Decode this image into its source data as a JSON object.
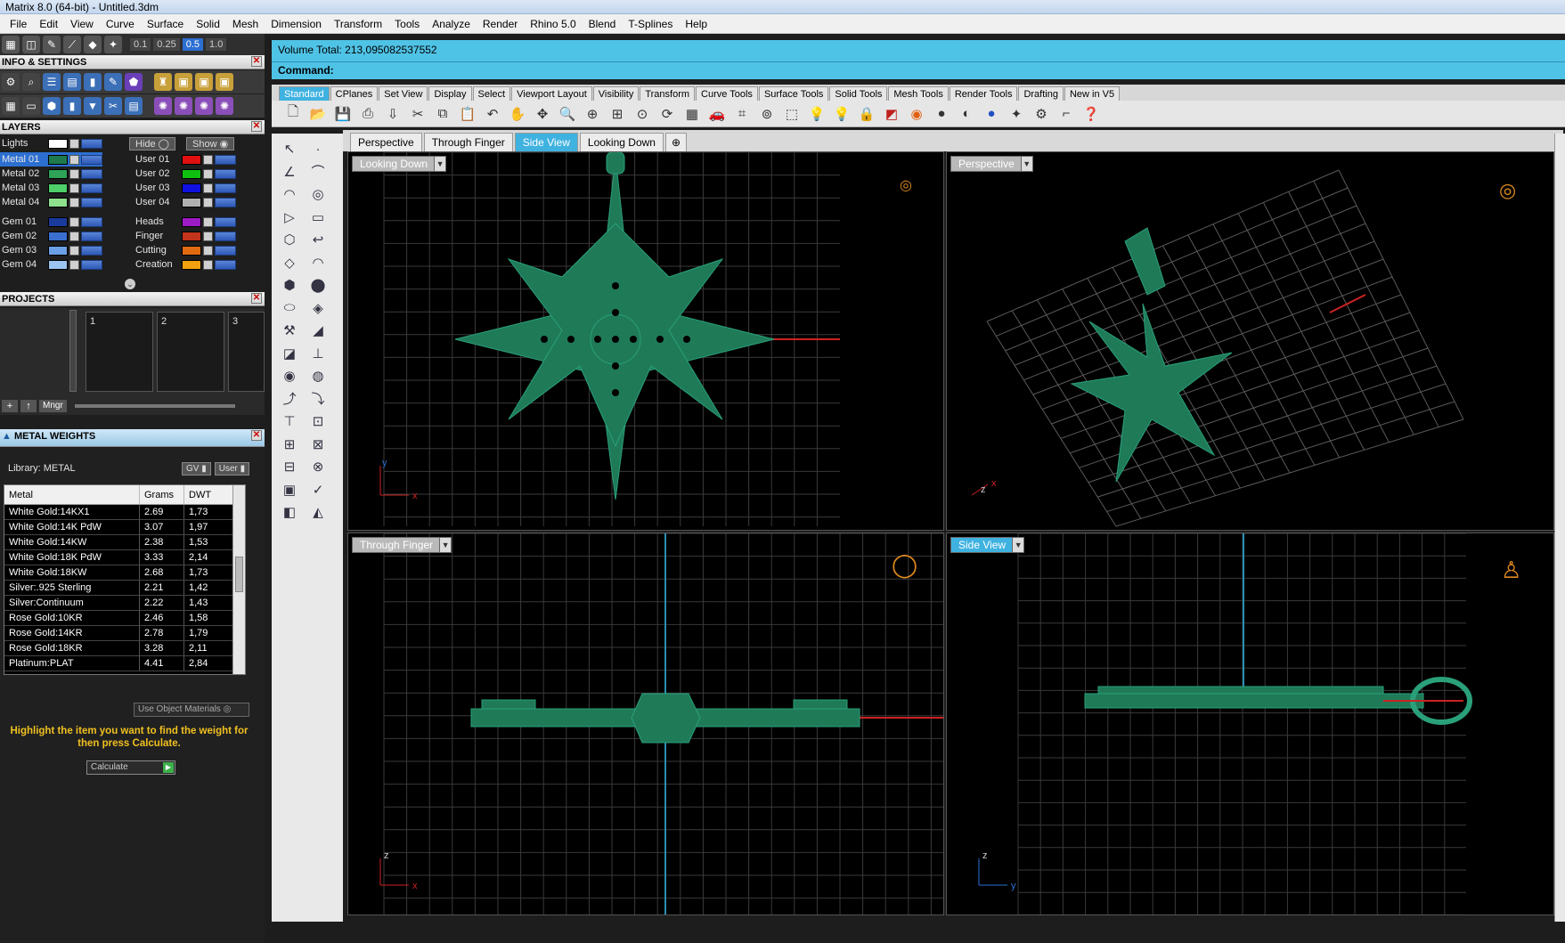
{
  "window": {
    "title": "Matrix 8.0 (64-bit) - Untitled.3dm"
  },
  "menu": [
    "File",
    "Edit",
    "View",
    "Curve",
    "Surface",
    "Solid",
    "Mesh",
    "Dimension",
    "Transform",
    "Tools",
    "Analyze",
    "Render",
    "Rhino 5.0",
    "Blend",
    "T-Splines",
    "Help"
  ],
  "toolbar": {
    "zoom_values": [
      "0.1",
      "0.25",
      "0.5",
      "1.0"
    ]
  },
  "info_settings": {
    "header": "INFO & SETTINGS"
  },
  "layers": {
    "header": "LAYERS",
    "lights_label": "Lights",
    "hide_label": "Hide",
    "show_label": "Show",
    "left": [
      {
        "name": "Metal 01",
        "color": "#1e7a4c"
      },
      {
        "name": "Metal 02",
        "color": "#2fa357"
      },
      {
        "name": "Metal 03",
        "color": "#4fcf6a"
      },
      {
        "name": "Metal 04",
        "color": "#8fe08d"
      },
      {
        "name": "Gem 01",
        "color": "#1a3a9c"
      },
      {
        "name": "Gem 02",
        "color": "#3a6fd0"
      },
      {
        "name": "Gem 03",
        "color": "#6b9fe6"
      },
      {
        "name": "Gem 04",
        "color": "#9cc4f0"
      }
    ],
    "right": [
      {
        "name": "User 01",
        "color": "#e01010"
      },
      {
        "name": "User 02",
        "color": "#10c010"
      },
      {
        "name": "User 03",
        "color": "#1010e0"
      },
      {
        "name": "User 04",
        "color": "#b0b0b0"
      },
      {
        "name": "Heads",
        "color": "#9b1cc4"
      },
      {
        "name": "Finger",
        "color": "#c2341c"
      },
      {
        "name": "Cutting",
        "color": "#e06a10"
      },
      {
        "name": "Creation",
        "color": "#f0a010"
      }
    ]
  },
  "projects": {
    "header": "PROJECTS",
    "slots": [
      "1",
      "2",
      "3"
    ],
    "manager_label": "Mngr"
  },
  "metal_weights": {
    "header": "METAL WEIGHTS",
    "library_label": "Library: METAL",
    "gv_label": "GV",
    "user_label": "User",
    "columns": [
      "Metal",
      "Grams",
      "DWT"
    ],
    "rows": [
      [
        "White Gold:14KX1",
        "2.69",
        "1,73"
      ],
      [
        "White Gold:14K PdW",
        "3.07",
        "1,97"
      ],
      [
        "White Gold:14KW",
        "2.38",
        "1,53"
      ],
      [
        "White Gold:18K PdW",
        "3.33",
        "2,14"
      ],
      [
        "White Gold:18KW",
        "2.68",
        "1,73"
      ],
      [
        "Silver:.925 Sterling",
        "2.21",
        "1,42"
      ],
      [
        "Silver:Continuum",
        "2.22",
        "1,43"
      ],
      [
        "Rose Gold:10KR",
        "2.46",
        "1,58"
      ],
      [
        "Rose Gold:14KR",
        "2.78",
        "1,79"
      ],
      [
        "Rose Gold:18KR",
        "3.28",
        "2,11"
      ],
      [
        "Platinum:PLAT",
        "4.41",
        "2,84"
      ]
    ],
    "use_object_materials": "Use Object Materials",
    "hint": "Highlight the item you want to find the weight for then press Calculate.",
    "calculate_label": "Calculate"
  },
  "status": {
    "volume_text": "Volume Total: 213,095082537552",
    "command_label": "Command:"
  },
  "tabs": [
    "Standard",
    "CPlanes",
    "Set View",
    "Display",
    "Select",
    "Viewport Layout",
    "Visibility",
    "Transform",
    "Curve Tools",
    "Surface Tools",
    "Solid Tools",
    "Mesh Tools",
    "Render Tools",
    "Drafting",
    "New in V5"
  ],
  "viewport_tabs": [
    "Perspective",
    "Through Finger",
    "Side View",
    "Looking Down"
  ],
  "viewports": {
    "top_left": "Looking Down",
    "top_right": "Perspective",
    "bottom_left": "Through Finger",
    "bottom_right": "Side View"
  },
  "axis_labels": {
    "x": "x",
    "y": "y",
    "z": "z"
  }
}
